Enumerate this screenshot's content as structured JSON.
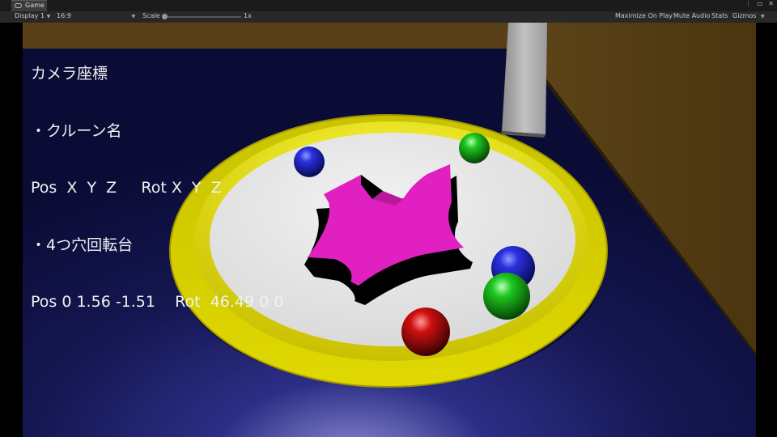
{
  "window": {
    "tab_label": "Game",
    "controls": "⋮ ▭ ✕"
  },
  "toolbar": {
    "display": "Display 1",
    "aspect": "16:9",
    "scale_label": "Scale",
    "scale_value": "1x",
    "maximize": "Maximize On Play",
    "mute": "Mute Audio",
    "stats": "Stats",
    "gizmos": "Gizmos"
  },
  "hud": {
    "line1": "カメラ座標",
    "line2": "・クルーン名",
    "line3": "Pos  X  Y  Z     Rot X  Y  Z",
    "line4": "・4つ穴回転台",
    "line5": "Pos 0 1.56 -1.51    Rot  46.49 0 0"
  },
  "scene": {
    "colors": {
      "floor": "#141650",
      "wall": "#5a4018",
      "rim": "#d8d000",
      "tray": "#e6e6e6",
      "turntable": "#e020c0",
      "post": "#aaaaaa"
    },
    "balls": [
      {
        "name": "blue-ball-top",
        "color": "blue"
      },
      {
        "name": "green-ball-top",
        "color": "green"
      },
      {
        "name": "blue-ball-right",
        "color": "blue"
      },
      {
        "name": "green-ball-right",
        "color": "green"
      },
      {
        "name": "red-ball",
        "color": "red"
      }
    ]
  }
}
